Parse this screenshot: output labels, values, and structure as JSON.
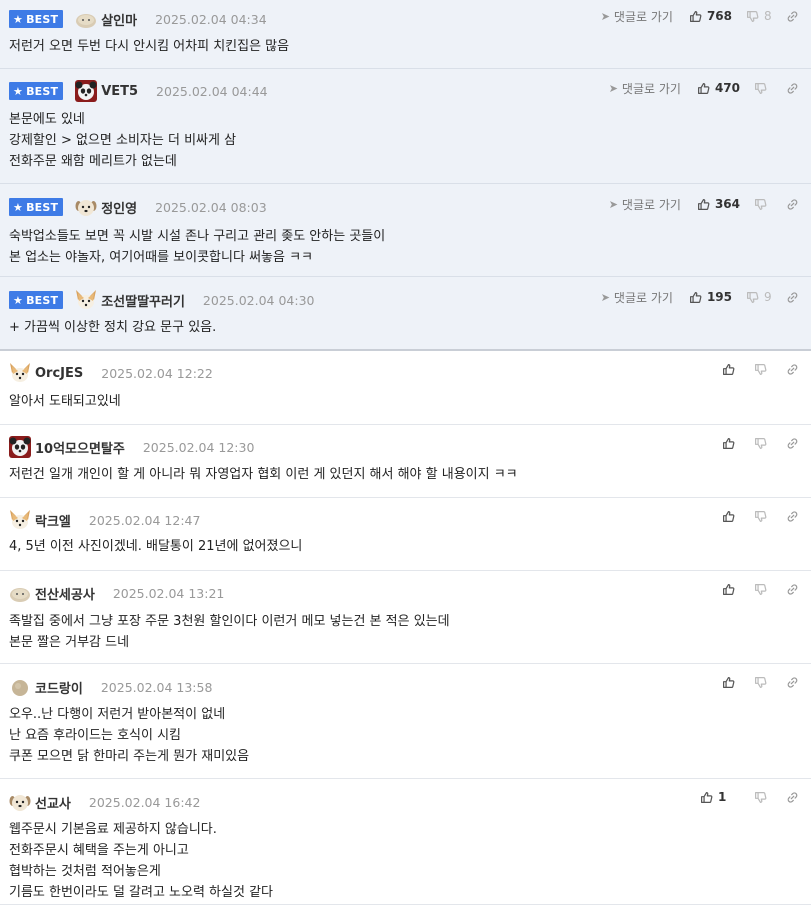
{
  "labels": {
    "best": "BEST",
    "goto": "댓글로 가기"
  },
  "colors": {
    "best_badge": "#3e7be6",
    "best_bg": "#eef2f8"
  },
  "comments": [
    {
      "best": true,
      "avatar": "blob-avatar",
      "nick": "살인마",
      "date": "2025.02.04 04:34",
      "goto": true,
      "up": "768",
      "down": "8",
      "lines": [
        "저런거 오면 두번 다시 안시킴 어차피 치킨집은 많음"
      ]
    },
    {
      "best": true,
      "avatar": "panda-avatar",
      "nick": "VET5",
      "date": "2025.02.04 04:44",
      "goto": true,
      "up": "470",
      "down": "",
      "lines": [
        "본문에도 있네",
        "강제할인 > 없으면 소비자는 더 비싸게 삼",
        "전화주문 왜함 메리트가 없는데"
      ]
    },
    {
      "best": true,
      "avatar": "dog-avatar",
      "nick": "정인영",
      "date": "2025.02.04 08:03",
      "goto": true,
      "up": "364",
      "down": "",
      "lines": [
        "숙박업소들도 보면 꼭 시발 시설 존나 구리고 관리 좆도 안하는 곳들이",
        "본 업소는 야놀자, 여기어때를 보이콧합니다 써놓음 ㅋㅋ"
      ]
    },
    {
      "best": true,
      "avatar": "fox-avatar",
      "nick": "조선딸딸꾸러기",
      "date": "2025.02.04 04:30",
      "goto": true,
      "up": "195",
      "down": "9",
      "lines": [
        "+ 가끔씩 이상한 정치 강요 문구 있음."
      ]
    },
    {
      "best": false,
      "avatar": "fox-avatar",
      "nick": "OrcJES",
      "date": "2025.02.04 12:22",
      "goto": false,
      "up": "",
      "down": "",
      "lines": [
        "알아서 도태되고있네"
      ]
    },
    {
      "best": false,
      "avatar": "panda-avatar",
      "nick": "10억모으면탈주",
      "date": "2025.02.04 12:30",
      "goto": false,
      "up": "",
      "down": "",
      "lines": [
        "저런건 일개 개인이 할 게 아니라 뭐 자영업자 협회 이런 게 있던지 해서 해야 할 내용이지 ㅋㅋ"
      ]
    },
    {
      "best": false,
      "avatar": "fox-avatar",
      "nick": "락크엘",
      "date": "2025.02.04 12:47",
      "goto": false,
      "up": "",
      "down": "",
      "lines": [
        "4, 5년 이전 사진이겠네. 배달통이 21년에 없어졌으니"
      ]
    },
    {
      "best": false,
      "avatar": "blob-avatar",
      "nick": "전산세공사",
      "date": "2025.02.04 13:21",
      "goto": false,
      "up": "",
      "down": "",
      "lines": [
        "족발집 중에서 그냥 포장 주문 3천원 할인이다 이런거 메모 넣는건 본 적은 있는데",
        "본문 짤은 거부감 드네"
      ]
    },
    {
      "best": false,
      "avatar": "ball-avatar",
      "nick": "코드랑이",
      "date": "2025.02.04 13:58",
      "goto": false,
      "up": "",
      "down": "",
      "lines": [
        "오우..난 다행이 저런거 받아본적이 없네",
        "난 요즘 후라이드는 호식이 시킴",
        "쿠폰 모으면 닭 한마리 주는게 뭔가 재미있음"
      ]
    },
    {
      "best": false,
      "avatar": "dog-avatar",
      "nick": "선교사",
      "date": "2025.02.04 16:42",
      "goto": false,
      "up": "1",
      "down": "",
      "lines": [
        "웹주문시 기본음료 제공하지 않습니다.",
        "전화주문시 혜택을 주는게 아니고",
        "협박하는 것처럼 적어놓은게",
        "기름도 한번이라도 덜 갈려고 노오력 하실것 같다"
      ]
    }
  ]
}
